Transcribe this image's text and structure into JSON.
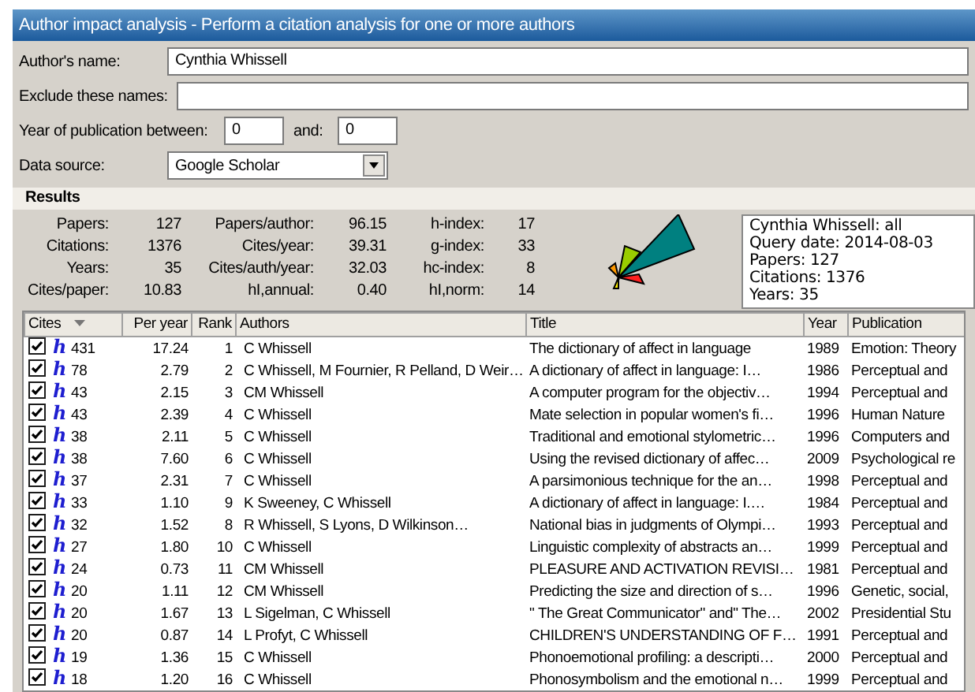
{
  "window": {
    "title": "Author impact analysis - Perform a citation analysis for one or more authors"
  },
  "form": {
    "authors_name": {
      "label": "Author's name:",
      "value": "Cynthia Whissell"
    },
    "exclude": {
      "label": "Exclude these names:"
    },
    "year": {
      "label": "Year of publication between:",
      "from": "0",
      "and_label": "and:",
      "to": "0"
    },
    "source": {
      "label": "Data source:",
      "value": "Google Scholar"
    }
  },
  "results": {
    "title": "Results",
    "stats": [
      {
        "label": "Papers:",
        "value": "127"
      },
      {
        "label": "Papers/author:",
        "value": "96.15"
      },
      {
        "label": "h-index:",
        "value": "17"
      },
      {
        "label": "Citations:",
        "value": "1376"
      },
      {
        "label": "Cites/year:",
        "value": "39.31"
      },
      {
        "label": "g-index:",
        "value": "33"
      },
      {
        "label": "Years:",
        "value": "35"
      },
      {
        "label": "Cites/auth/year:",
        "value": "32.03"
      },
      {
        "label": "hc-index:",
        "value": "8"
      },
      {
        "label": "Cites/paper:",
        "value": "10.83"
      },
      {
        "label": "hI,annual:",
        "value": "0.40"
      },
      {
        "label": "hI,norm:",
        "value": "14"
      }
    ],
    "summary": [
      "Cynthia Whissell: all",
      "Query date: 2014-08-03",
      "Papers: 127",
      "Citations: 1376",
      "Years: 35"
    ]
  },
  "table": {
    "columns": [
      "Cites",
      "Per year",
      "Rank",
      "Authors",
      "Title",
      "Year",
      "Publication"
    ],
    "rows": [
      {
        "checked": true,
        "badge": "h",
        "cites": "431",
        "per_year": "17.24",
        "rank": "1",
        "authors": "C Whissell",
        "title": "The dictionary of affect in language",
        "year": "1989",
        "publication": "Emotion: Theory"
      },
      {
        "checked": true,
        "badge": "h",
        "cites": "78",
        "per_year": "2.79",
        "rank": "2",
        "authors": "C Whissell, M Fournier, R Pelland, D Weir…",
        "title": "A dictionary of affect in language: I…",
        "year": "1986",
        "publication": "Perceptual and"
      },
      {
        "checked": true,
        "badge": "h",
        "cites": "43",
        "per_year": "2.15",
        "rank": "3",
        "authors": "CM Whissell",
        "title": "A computer program for the objectiv…",
        "year": "1994",
        "publication": "Perceptual and"
      },
      {
        "checked": true,
        "badge": "h",
        "cites": "43",
        "per_year": "2.39",
        "rank": "4",
        "authors": "C Whissell",
        "title": "Mate selection in popular women's fi…",
        "year": "1996",
        "publication": "Human Nature"
      },
      {
        "checked": true,
        "badge": "h",
        "cites": "38",
        "per_year": "2.11",
        "rank": "5",
        "authors": "C Whissell",
        "title": "Traditional and emotional stylometric…",
        "year": "1996",
        "publication": "Computers and"
      },
      {
        "checked": true,
        "badge": "h",
        "cites": "38",
        "per_year": "7.60",
        "rank": "6",
        "authors": "C Whissell",
        "title": "Using the revised dictionary of affec…",
        "year": "2009",
        "publication": "Psychological re"
      },
      {
        "checked": true,
        "badge": "h",
        "cites": "37",
        "per_year": "2.31",
        "rank": "7",
        "authors": "C Whissell",
        "title": "A parsimonious technique for the an…",
        "year": "1998",
        "publication": "Perceptual and"
      },
      {
        "checked": true,
        "badge": "h",
        "cites": "33",
        "per_year": "1.10",
        "rank": "9",
        "authors": "K Sweeney, C Whissell",
        "title": "A dictionary of affect in language: I.…",
        "year": "1984",
        "publication": "Perceptual and"
      },
      {
        "checked": true,
        "badge": "h",
        "cites": "32",
        "per_year": "1.52",
        "rank": "8",
        "authors": "R Whissell, S Lyons, D Wilkinson…",
        "title": "National bias in judgments of Olympi…",
        "year": "1993",
        "publication": "Perceptual and"
      },
      {
        "checked": true,
        "badge": "h",
        "cites": "27",
        "per_year": "1.80",
        "rank": "10",
        "authors": "C Whissell",
        "title": "Linguistic complexity of abstracts an…",
        "year": "1999",
        "publication": "Perceptual and"
      },
      {
        "checked": true,
        "badge": "h",
        "cites": "24",
        "per_year": "0.73",
        "rank": "11",
        "authors": "CM Whissell",
        "title": "PLEASURE AND ACTIVATION REVISI…",
        "year": "1981",
        "publication": "Perceptual and"
      },
      {
        "checked": true,
        "badge": "h",
        "cites": "20",
        "per_year": "1.11",
        "rank": "12",
        "authors": "CM Whissell",
        "title": "Predicting the size and direction of s…",
        "year": "1996",
        "publication": "Genetic, social,"
      },
      {
        "checked": true,
        "badge": "h",
        "cites": "20",
        "per_year": "1.67",
        "rank": "13",
        "authors": "L Sigelman, C Whissell",
        "title": "\" The Great Communicator\" and\" The…",
        "year": "2002",
        "publication": "Presidential Stu"
      },
      {
        "checked": true,
        "badge": "h",
        "cites": "20",
        "per_year": "0.87",
        "rank": "14",
        "authors": "L Profyt, C Whissell",
        "title": "CHILDREN'S UNDERSTANDING OF F…",
        "year": "1991",
        "publication": "Perceptual and"
      },
      {
        "checked": true,
        "badge": "h",
        "cites": "19",
        "per_year": "1.36",
        "rank": "15",
        "authors": "C Whissell",
        "title": "Phonoemotional profiling: a descripti…",
        "year": "2000",
        "publication": "Perceptual and"
      },
      {
        "checked": true,
        "badge": "h",
        "cites": "18",
        "per_year": "1.20",
        "rank": "16",
        "authors": "C Whissell",
        "title": "Phonosymbolism and the emotional n…",
        "year": "1999",
        "publication": "Perceptual and"
      }
    ]
  }
}
